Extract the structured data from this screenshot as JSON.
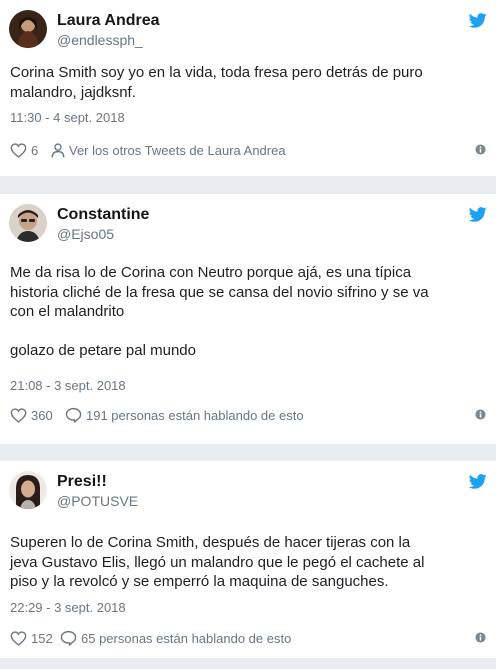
{
  "colors": {
    "twitter_blue": "#1da1f2",
    "name": "#14171a",
    "meta": "#657786"
  },
  "tweets": [
    {
      "name": "Laura Andrea",
      "handle": "@endlessph_",
      "text": "Corina Smith soy yo en la vida, toda fresa pero detrás de puro\nmalandro, jajdksnf.",
      "time": "11:30 - 4 sept. 2018",
      "likes": "6",
      "secondary_action": "Ver los otros Tweets de Laura Andrea",
      "secondary_icon": "person-icon"
    },
    {
      "name": "Constantine",
      "handle": "@Ejso05",
      "text": "Me da risa lo de Corina con Neutro porque ajá, es una típica\nhistoria cliché de la fresa que se cansa del novio sifrino y se va\ncon el malandrito\n\ngolazo de petare pal mundo",
      "time": "21:08 - 3 sept. 2018",
      "likes": "360",
      "secondary_action": "191 personas están hablando de esto",
      "secondary_icon": "comment-icon"
    },
    {
      "name": "Presi!!",
      "handle": "@POTUSVE",
      "text": "Superen lo de Corina Smith, después de hacer tijeras con la\njeva Gustavo Elis, llegó un malandro que le pegó el cachete al\npiso y la revolcó y se emperró la maquina de sanguches.",
      "time": "22:29 - 3 sept. 2018",
      "likes": "152",
      "secondary_action": "65 personas están hablando de esto",
      "secondary_icon": "comment-icon"
    }
  ]
}
